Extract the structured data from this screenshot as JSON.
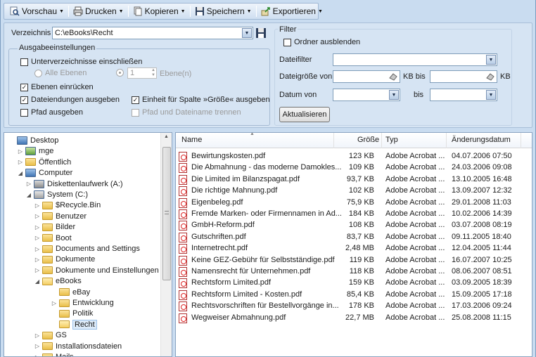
{
  "toolbar": {
    "preview_label": "Vorschau",
    "print_label": "Drucken",
    "copy_label": "Kopieren",
    "save_label": "Speichern",
    "export_label": "Exportieren"
  },
  "directory": {
    "label": "Verzeichnis",
    "value": "C:\\eBooks\\Recht"
  },
  "output_settings": {
    "title": "Ausgabeeinstellungen",
    "include_subdirs": "Unterverzeichnisse einschließen",
    "all_levels": "Alle Ebenen",
    "levels_value": "1",
    "levels_label": "Ebene(n)",
    "indent_levels": "Ebenen einrücken",
    "file_extensions": "Dateiendungen ausgeben",
    "size_unit": "Einheit für Spalte »Größe« ausgeben",
    "print_path": "Pfad ausgeben",
    "split_path": "Pfad und Dateiname trennen"
  },
  "filter": {
    "title": "Filter",
    "hide_folders": "Ordner ausblenden",
    "file_filter_label": "Dateifilter",
    "size_from_label": "Dateigröße von",
    "kb_to_label": "KB bis",
    "kb_label": "KB",
    "date_from_label": "Datum von",
    "to_label": "bis",
    "refresh_button": "Aktualisieren"
  },
  "tree": [
    {
      "label": "Desktop",
      "level": 0,
      "exp": "",
      "icon": "desktop-icon"
    },
    {
      "label": "mge",
      "level": 1,
      "exp": "▷",
      "icon": "user-icon"
    },
    {
      "label": "Öffentlich",
      "level": 1,
      "exp": "▷",
      "icon": "folder-icon"
    },
    {
      "label": "Computer",
      "level": 1,
      "exp": "◢",
      "icon": "computer-icon"
    },
    {
      "label": "Diskettenlaufwerk (A:)",
      "level": 2,
      "exp": "▷",
      "icon": "floppy-icon"
    },
    {
      "label": "System (C:)",
      "level": 2,
      "exp": "◢",
      "icon": "drive-icon"
    },
    {
      "label": "$Recycle.Bin",
      "level": 3,
      "exp": "▷",
      "icon": "folder-icon"
    },
    {
      "label": "Benutzer",
      "level": 3,
      "exp": "▷",
      "icon": "folder-icon"
    },
    {
      "label": "Bilder",
      "level": 3,
      "exp": "▷",
      "icon": "folder-icon"
    },
    {
      "label": "Boot",
      "level": 3,
      "exp": "▷",
      "icon": "folder-icon"
    },
    {
      "label": "Documents and Settings",
      "level": 3,
      "exp": "▷",
      "icon": "folder-icon"
    },
    {
      "label": "Dokumente",
      "level": 3,
      "exp": "▷",
      "icon": "folder-icon"
    },
    {
      "label": "Dokumente und Einstellungen",
      "level": 3,
      "exp": "▷",
      "icon": "folder-icon"
    },
    {
      "label": "eBooks",
      "level": 3,
      "exp": "◢",
      "icon": "folder-open-icon"
    },
    {
      "label": "eBay",
      "level": 4,
      "exp": "",
      "icon": "folder-icon"
    },
    {
      "label": "Entwicklung",
      "level": 4,
      "exp": "▷",
      "icon": "folder-icon"
    },
    {
      "label": "Politik",
      "level": 4,
      "exp": "",
      "icon": "folder-icon"
    },
    {
      "label": "Recht",
      "level": 4,
      "exp": "",
      "icon": "folder-open-icon",
      "selected": true
    },
    {
      "label": "GS",
      "level": 3,
      "exp": "▷",
      "icon": "folder-icon"
    },
    {
      "label": "Installationsdateien",
      "level": 3,
      "exp": "▷",
      "icon": "folder-icon"
    },
    {
      "label": "Mails",
      "level": 3,
      "exp": "▷",
      "icon": "folder-icon"
    }
  ],
  "list": {
    "headers": {
      "name": "Name",
      "size": "Größe",
      "type": "Typ",
      "date": "Änderungsdatum"
    },
    "rows": [
      {
        "name": "Bewirtungskosten.pdf",
        "size": "123 KB",
        "type": "Adobe Acrobat ...",
        "date": "04.07.2006 07:50"
      },
      {
        "name": "Die Abmahnung - das moderne Damokles...",
        "size": "109 KB",
        "type": "Adobe Acrobat ...",
        "date": "24.03.2006 09:08"
      },
      {
        "name": "Die Limited im Bilanzspagat.pdf",
        "size": "93,7 KB",
        "type": "Adobe Acrobat ...",
        "date": "13.10.2005 16:48"
      },
      {
        "name": "Die richtige Mahnung.pdf",
        "size": "102 KB",
        "type": "Adobe Acrobat ...",
        "date": "13.09.2007 12:32"
      },
      {
        "name": "Eigenbeleg.pdf",
        "size": "75,9 KB",
        "type": "Adobe Acrobat ...",
        "date": "29.01.2008 11:03"
      },
      {
        "name": "Fremde Marken- oder Firmennamen in Ad...",
        "size": "184 KB",
        "type": "Adobe Acrobat ...",
        "date": "10.02.2006 14:39"
      },
      {
        "name": "GmbH-Reform.pdf",
        "size": "108 KB",
        "type": "Adobe Acrobat ...",
        "date": "03.07.2008 08:19"
      },
      {
        "name": "Gutschriften.pdf",
        "size": "83,7 KB",
        "type": "Adobe Acrobat ...",
        "date": "09.11.2005 18:40"
      },
      {
        "name": "Internetrecht.pdf",
        "size": "2,48 MB",
        "type": "Adobe Acrobat ...",
        "date": "12.04.2005 11:44"
      },
      {
        "name": "Keine GEZ-Gebühr für Selbstständige.pdf",
        "size": "119 KB",
        "type": "Adobe Acrobat ...",
        "date": "16.07.2007 10:25"
      },
      {
        "name": "Namensrecht für Unternehmen.pdf",
        "size": "118 KB",
        "type": "Adobe Acrobat ...",
        "date": "08.06.2007 08:51"
      },
      {
        "name": "Rechtsform Limited.pdf",
        "size": "159 KB",
        "type": "Adobe Acrobat ...",
        "date": "03.09.2005 18:39"
      },
      {
        "name": "Rechtsform Limited - Kosten.pdf",
        "size": "85,4 KB",
        "type": "Adobe Acrobat ...",
        "date": "15.09.2005 17:18"
      },
      {
        "name": "Rechtsvorschriften für Bestellvorgänge in...",
        "size": "178 KB",
        "type": "Adobe Acrobat ...",
        "date": "17.03.2006 09:24"
      },
      {
        "name": "Wegweiser Abmahnung.pdf",
        "size": "22,7 MB",
        "type": "Adobe Acrobat ...",
        "date": "25.08.2008 11:15"
      }
    ]
  }
}
